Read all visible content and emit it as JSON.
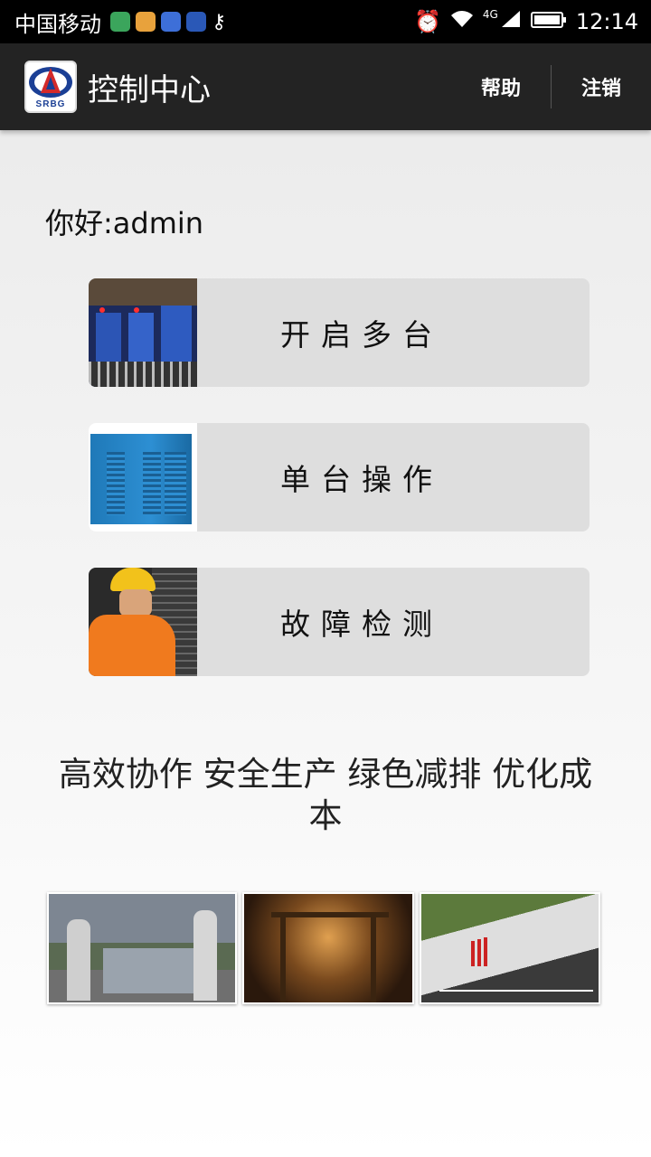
{
  "status_bar": {
    "carrier": "中国移动",
    "network": "4G",
    "time": "12:14",
    "app_icons": [
      "play-store-icon",
      "browser-icon",
      "baidu-icon",
      "autohome-icon",
      "key-icon"
    ],
    "system_icons": [
      "alarm-icon",
      "wifi-icon",
      "signal-icon",
      "battery-icon"
    ]
  },
  "app_bar": {
    "logo_text": "SRBG",
    "title": "控制中心",
    "help_label": "帮助",
    "logout_label": "注销"
  },
  "greeting": "你好:admin",
  "menu": [
    {
      "label": "开启多台",
      "image": "multiple-compressors-photo"
    },
    {
      "label": "单台操作",
      "image": "single-compressor-photo"
    },
    {
      "label": "故障检测",
      "image": "worker-inspection-photo"
    }
  ],
  "slogan": "高效协作 安全生产 绿色减排 优化成本",
  "gallery": [
    "concrete-plant-photo",
    "tunnel-construction-photo",
    "highway-slope-photo"
  ],
  "colors": {
    "app_bar": "#232323",
    "status_bar": "#000000",
    "button_bg": "#dedede"
  }
}
